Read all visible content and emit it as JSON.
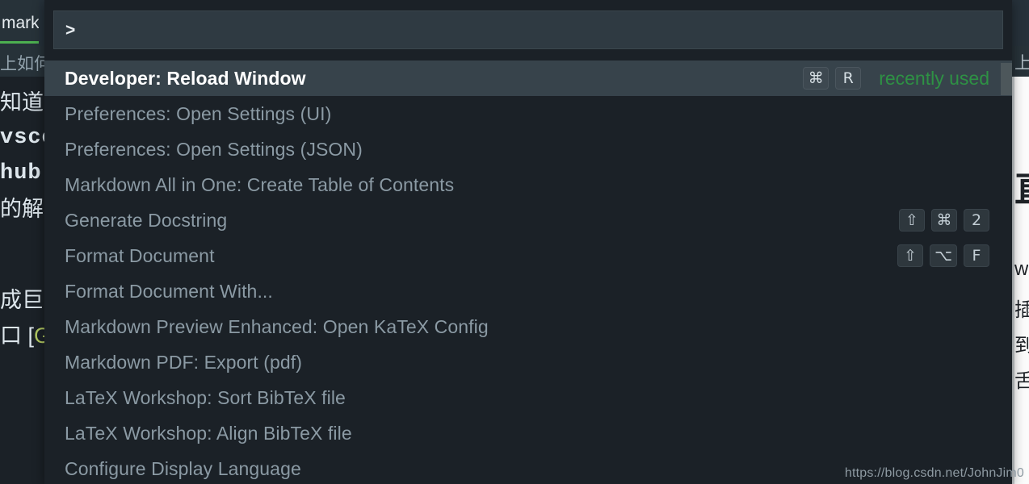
{
  "editor": {
    "tab_label": "mark",
    "breadcrumb": "上如何",
    "code_lines": [
      {
        "text": "知道",
        "style": "plain"
      },
      {
        "text": "vsco",
        "style": "mono"
      },
      {
        "text": "hub::",
        "style": "mono"
      },
      {
        "text": "的解",
        "style": "plain"
      },
      {
        "text": "",
        "style": "plain"
      },
      {
        "text": "成巨",
        "style": "plain"
      }
    ],
    "code_last_line": {
      "bracket": "口 [",
      "link_open": "[",
      "link_text": "G",
      "dot": "."
    }
  },
  "preview": {
    "breadcrumb": "上",
    "heading": "直",
    "lines": [
      "w",
      "插",
      "到",
      "舌"
    ]
  },
  "palette": {
    "input_value": ">",
    "input_placeholder": "",
    "rows": [
      {
        "label": "Developer: Reload Window",
        "selected": true,
        "keys": [
          "⌘",
          "R"
        ],
        "badge": "recently used"
      },
      {
        "label": "Preferences: Open Settings (UI)",
        "selected": false,
        "keys": [],
        "badge": ""
      },
      {
        "label": "Preferences: Open Settings (JSON)",
        "selected": false,
        "keys": [],
        "badge": ""
      },
      {
        "label": "Markdown All in One: Create Table of Contents",
        "selected": false,
        "keys": [],
        "badge": ""
      },
      {
        "label": "Generate Docstring",
        "selected": false,
        "keys": [
          "⇧",
          "⌘",
          "2"
        ],
        "badge": ""
      },
      {
        "label": "Format Document",
        "selected": false,
        "keys": [
          "⇧",
          "⌥",
          "F"
        ],
        "badge": ""
      },
      {
        "label": "Format Document With...",
        "selected": false,
        "keys": [],
        "badge": ""
      },
      {
        "label": "Markdown Preview Enhanced: Open KaTeX Config",
        "selected": false,
        "keys": [],
        "badge": ""
      },
      {
        "label": "Markdown PDF: Export (pdf)",
        "selected": false,
        "keys": [],
        "badge": ""
      },
      {
        "label": "LaTeX Workshop: Sort BibTeX file",
        "selected": false,
        "keys": [],
        "badge": ""
      },
      {
        "label": "LaTeX Workshop: Align BibTeX file",
        "selected": false,
        "keys": [],
        "badge": ""
      },
      {
        "label": "Configure Display Language",
        "selected": false,
        "keys": [],
        "badge": ""
      }
    ]
  },
  "watermark": "https://blog.csdn.net/JohnJim0",
  "colors": {
    "palette_bg": "#1b2127",
    "input_bg": "#2f3a42",
    "row_selected_bg": "#37434b",
    "row_text": "#8b9aa4",
    "row_selected_text": "#ffffff",
    "recent_green": "#2e9144",
    "tab_underline": "#4caf50",
    "scrollbar_thumb": "#4d575b"
  }
}
